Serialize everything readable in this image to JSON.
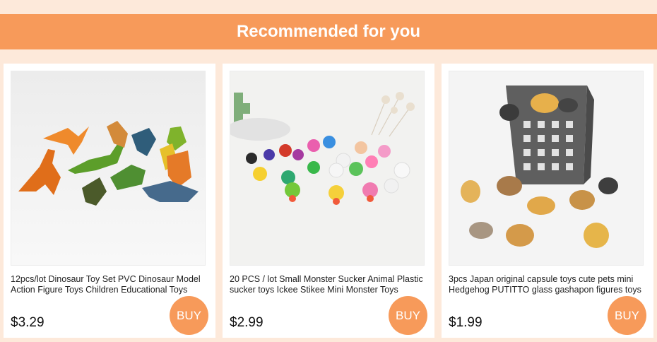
{
  "header": {
    "title": "Recommended for you"
  },
  "products": [
    {
      "title": "12pcs/lot Dinosaur Toy Set PVC Dinosaur Model Action Figure Toys Children Educational Toys",
      "price": "$3.29",
      "buy_label": "BUY",
      "image_subject": "dinosaur-toy-set"
    },
    {
      "title": "20 PCS / lot Small Monster Sucker Animal Plastic sucker toys Ickee Stikee Mini Monster Toys",
      "price": "$2.99",
      "buy_label": "BUY",
      "image_subject": "monster-sucker-toys"
    },
    {
      "title": "3pcs Japan original capsule toys cute pets mini Hedgehog PUTITTO glass gashapon figures toys",
      "price": "$1.99",
      "buy_label": "BUY",
      "image_subject": "hedgehog-figures"
    }
  ],
  "colors": {
    "accent": "#f79a5a",
    "page_background": "#fde9da"
  }
}
